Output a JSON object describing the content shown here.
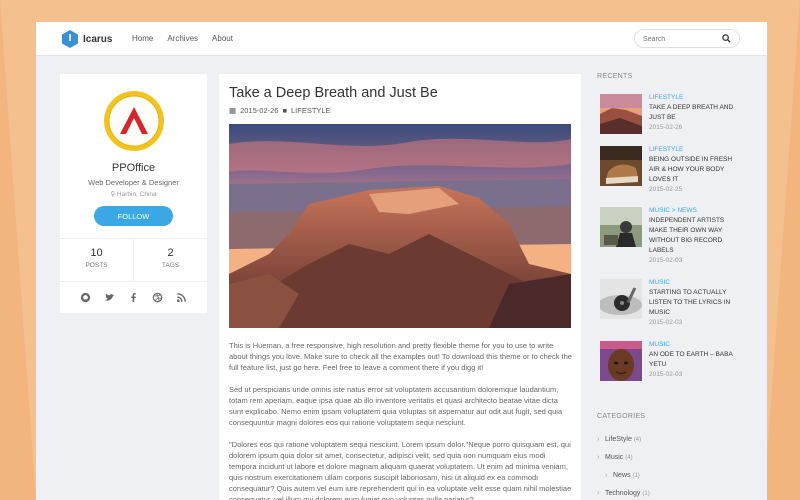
{
  "header": {
    "logo_text": "Icarus",
    "logo_letter": "I",
    "nav": [
      "Home",
      "Archives",
      "About"
    ],
    "search_placeholder": "Search"
  },
  "profile": {
    "name": "PPOffice",
    "title": "Web Developer & Designer",
    "location": "Harbin, China",
    "follow_label": "FOLLOW",
    "posts_count": "10",
    "posts_label": "POSTS",
    "tags_count": "2",
    "tags_label": "TAGS",
    "socials": [
      "github-icon",
      "twitter-icon",
      "facebook-icon",
      "dribbble-icon",
      "rss-icon"
    ],
    "accent": "#3ba8e5"
  },
  "article": {
    "title": "Take a Deep Breath and Just Be",
    "date": "2015-02-26",
    "category": "LIFESTYLE",
    "paragraphs": [
      "This is Hueman, a free responsive, high resolution and pretty flexible theme for you to use to write about things you love. Make sure to check all the examples out! To download this theme or to check the full feature list, just go here. Feel free to leave a comment there if you digg it!",
      "Sed ut perspiciatis unde omnis iste natus error sit voluptatem accusantium doloremque laudantium, totam rem aperiam, eaque ipsa quae ab illo inventore veritatis et quasi architecto beatae vitae dicta sunt explicabo. Nemo enim ipsam voluptatem quia voluptas sit aspernatur aut odit aut fugit, sed quia consequuntur magni dolores eos qui ratione voluptatem sequi nesciunt.",
      "\"Dolores eos qui ratione voluptatem sequi nesciunt. Lorem ipsum dolor.\"Neque porro quisquam est, qui dolorem ipsum quia dolor sit amet, consectetur, adipisci velit, sed quia non numquam eius modi tempora incidunt ut labore et dolore magnam aliquam quaerat voluptatem. Ut enim ad minima veniam, quis nostrum exercitationem ullam corporis suscipit laboriosam, nisi ut aliquid ex ea commodi consequatur? Quis autem vel eum iure reprehenderit qui in ea voluptate velit esse quam nihil molestiae consequatur, vel illum qui dolorem eum fugiat quo voluptas nulla pariatur?"
    ]
  },
  "recents": {
    "heading": "RECENTS",
    "items": [
      {
        "category": "LIFESTYLE",
        "title": "TAKE A DEEP BREATH AND JUST BE",
        "date": "2015-02-26"
      },
      {
        "category": "LIFESTYLE",
        "title": "BEING OUTSIDE IN FRESH AIR & HOW YOUR BODY LOVES IT",
        "date": "2015-02-25"
      },
      {
        "category": "MUSIC > NEWS",
        "title": "INDEPENDENT ARTISTS MAKE THEIR OWN WAY WITHOUT BIG RECORD LABELS",
        "date": "2015-02-03"
      },
      {
        "category": "MUSIC",
        "title": "STARTING TO ACTUALLY LISTEN TO THE LYRICS IN MUSIC",
        "date": "2015-02-03"
      },
      {
        "category": "MUSIC",
        "title": "AN ODE TO EARTH – BABA YETU",
        "date": "2015-02-03"
      }
    ]
  },
  "categories": {
    "heading": "CATEGORIES",
    "items": [
      {
        "name": "LifeStyle",
        "count": "(4)"
      },
      {
        "name": "Music",
        "count": "(4)"
      },
      {
        "name": "News",
        "count": "(1)"
      },
      {
        "name": "Technology",
        "count": "(1)"
      }
    ]
  }
}
